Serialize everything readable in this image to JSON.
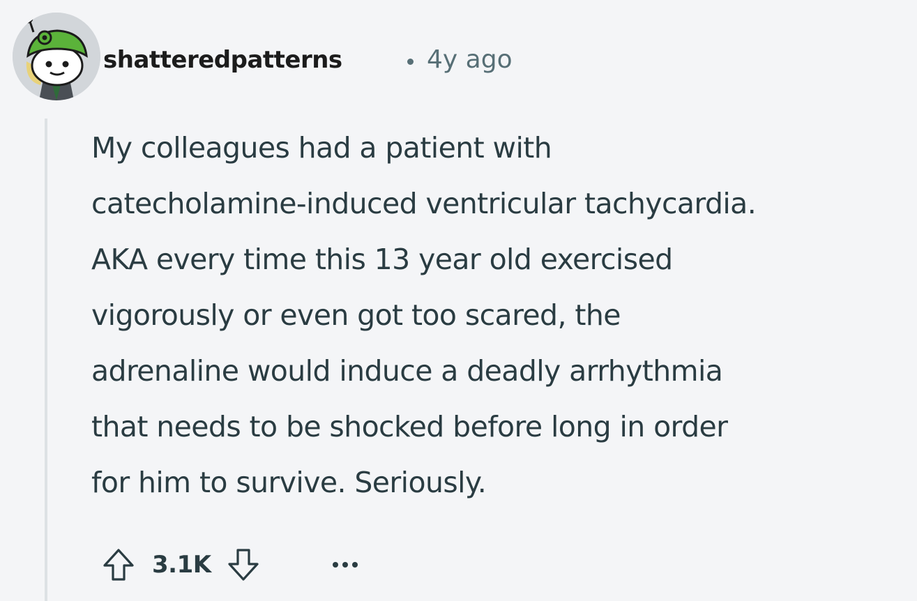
{
  "comment": {
    "author": "shatteredpatterns",
    "separator": "•",
    "age": "4y ago",
    "body_lines": [
      "My colleagues had a patient with",
      "catecholamine-induced ventricular tachycardia.",
      "AKA every time this 13 year old exercised",
      "vigorously or even got too scared, the",
      "adrenaline would induce a deadly arrhythmia",
      "that needs to be shocked before long in order",
      "for him to survive. Seriously."
    ],
    "score": "3.1K",
    "more_icon": "ellipsis-icon",
    "upvote_icon": "upvote-arrow-icon",
    "downvote_icon": "downvote-arrow-icon"
  },
  "colors": {
    "background": "#f4f5f7",
    "text": "#2a3c42",
    "meta": "#576f76",
    "thread_line": "#dde1e4",
    "avatar_green": "#5bb33a"
  }
}
